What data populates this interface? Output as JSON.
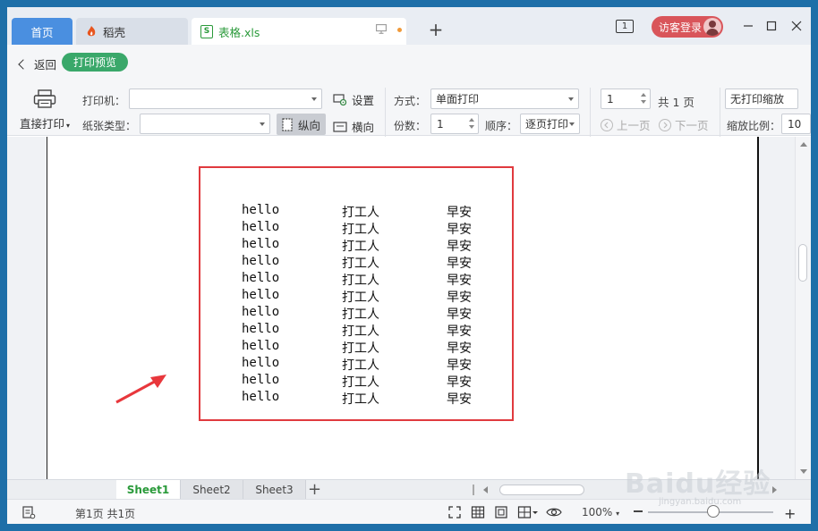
{
  "tabs": {
    "home": "首页",
    "daoke": "稻壳",
    "file": "表格.xls"
  },
  "titlebar": {
    "window_indicator": "1",
    "login": "访客登录"
  },
  "toolbar": {
    "back": "返回",
    "mode": "打印预览",
    "direct_print": "直接打印",
    "printer_label": "打印机：",
    "printer_value": "",
    "paper_label": "纸张类型：",
    "paper_value": "",
    "settings": "设置",
    "portrait": "纵向",
    "landscape": "横向",
    "method_label": "方式：",
    "method_value": "单面打印",
    "copies_label": "份数：",
    "copies_value": "1",
    "order_label": "顺序：",
    "order_value": "逐页打印",
    "page_value": "1",
    "page_total": "共 1 页",
    "prev_page": "上一页",
    "next_page": "下一页",
    "scale_select": "无打印缩放",
    "scale_label": "缩放比例：",
    "scale_value": "10"
  },
  "sheet_rows": [
    [
      "hello",
      "打工人",
      "早安"
    ],
    [
      "hello",
      "打工人",
      "早安"
    ],
    [
      "hello",
      "打工人",
      "早安"
    ],
    [
      "hello",
      "打工人",
      "早安"
    ],
    [
      "hello",
      "打工人",
      "早安"
    ],
    [
      "hello",
      "打工人",
      "早安"
    ],
    [
      "hello",
      "打工人",
      "早安"
    ],
    [
      "hello",
      "打工人",
      "早安"
    ],
    [
      "hello",
      "打工人",
      "早安"
    ],
    [
      "hello",
      "打工人",
      "早安"
    ],
    [
      "hello",
      "打工人",
      "早安"
    ],
    [
      "hello",
      "打工人",
      "早安"
    ]
  ],
  "sheets": [
    "Sheet1",
    "Sheet2",
    "Sheet3"
  ],
  "status": {
    "page_info": "第1页 共1页",
    "zoom": "100%",
    "zoom_level_fraction": 0.5
  },
  "watermark": {
    "text": "Baidu经验",
    "sub": "jingyan.baidu.com"
  },
  "colors": {
    "accent_green": "#2a9a3a",
    "highlight_red": "#e03a3e",
    "login_red": "#d9555a",
    "home_tab_blue": "#4a8fe0"
  }
}
